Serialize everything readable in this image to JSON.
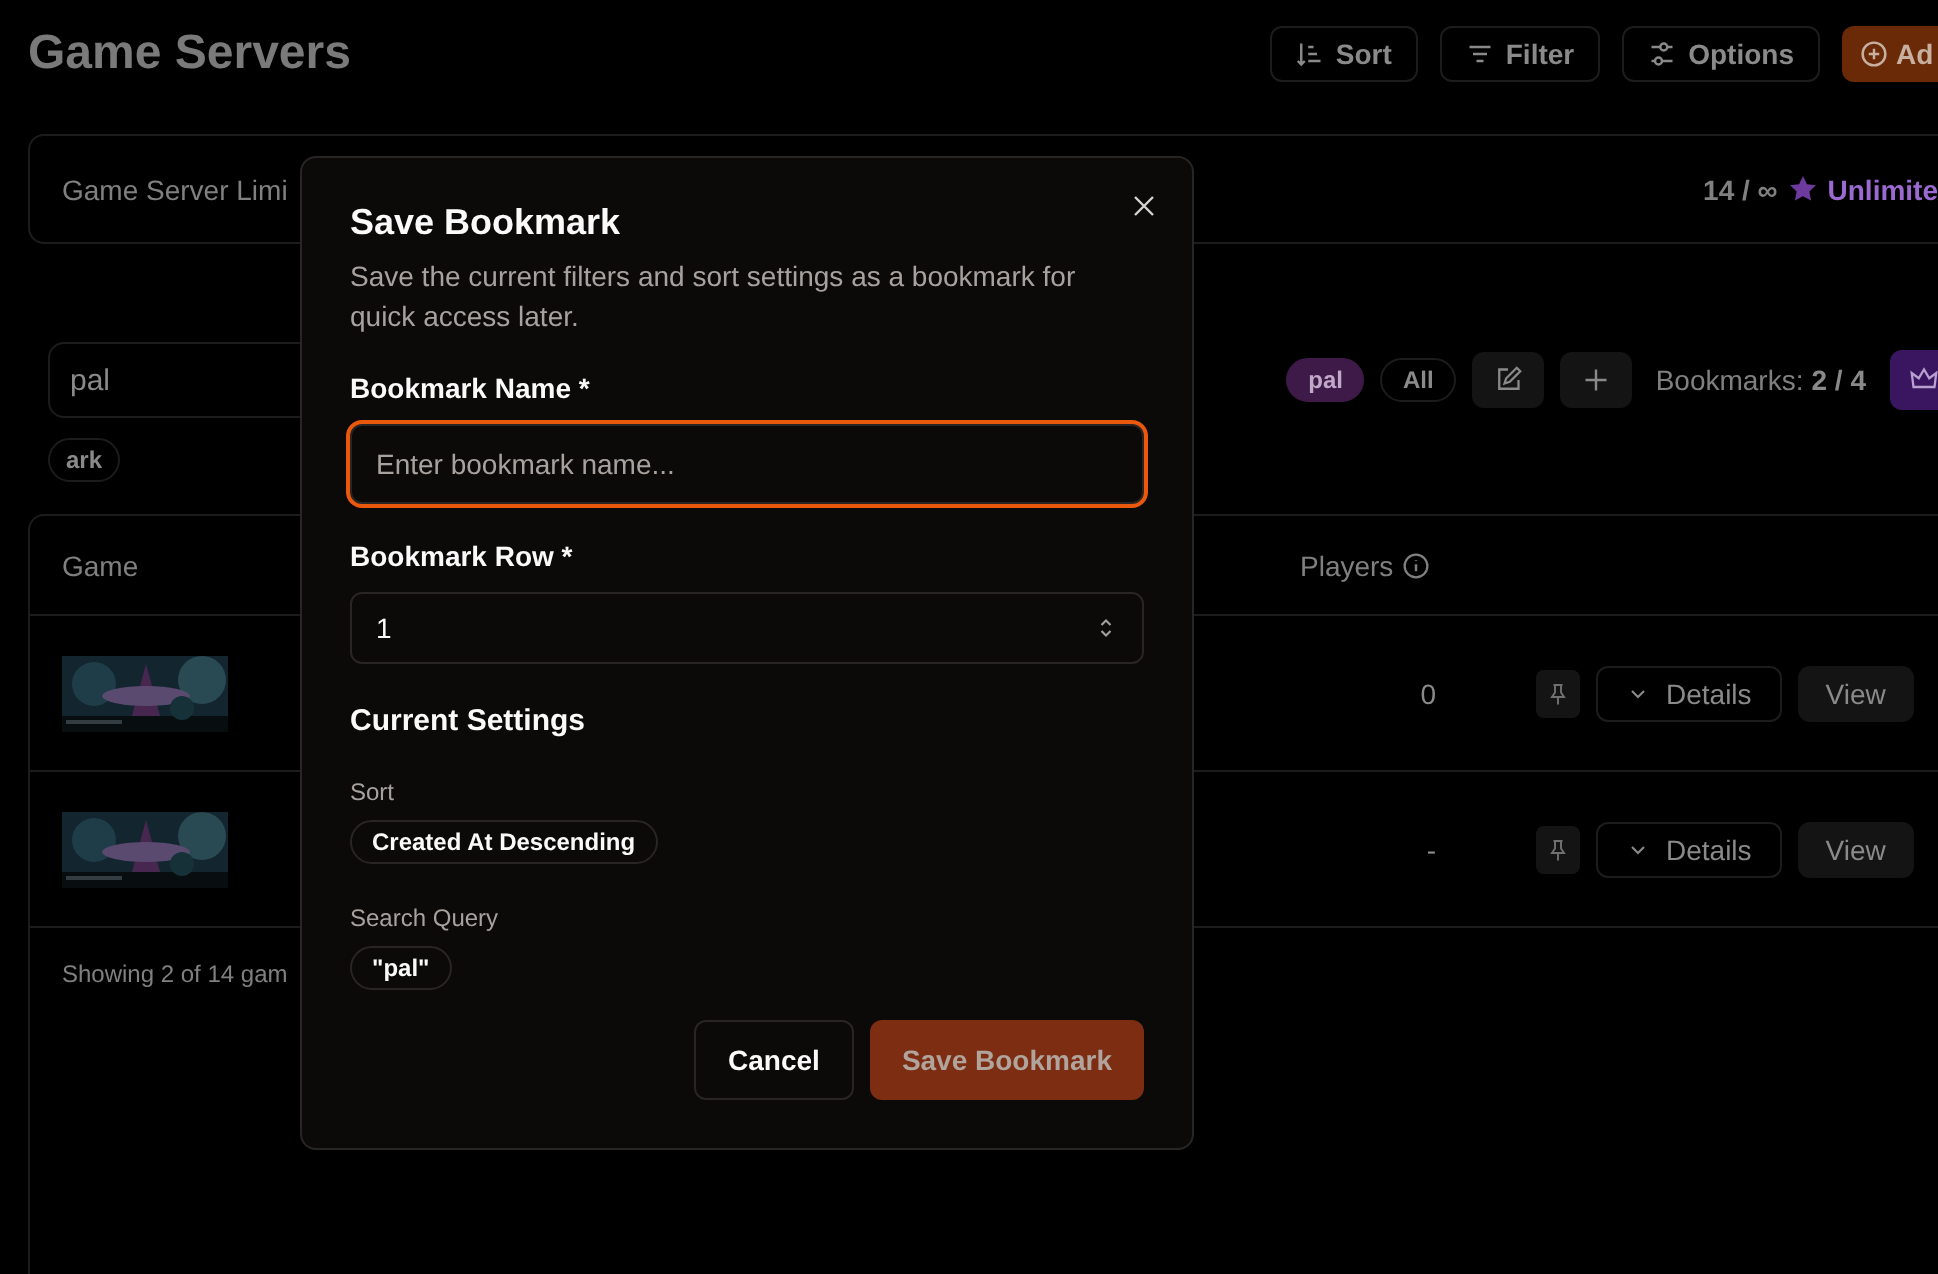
{
  "page": {
    "title": "Game Servers",
    "toolbar": [
      {
        "label": "Sort",
        "kind": "sort"
      },
      {
        "label": "Filter",
        "kind": "filter"
      },
      {
        "label": "Options",
        "kind": "options"
      },
      {
        "label": "Ad",
        "kind": "add"
      }
    ]
  },
  "limits": {
    "label": "Game Server Limi",
    "usage": "14 / ∞",
    "plan": "Unlimite"
  },
  "search": {
    "value": "pal"
  },
  "tags": [
    {
      "label": "ark"
    }
  ],
  "bookmarks": {
    "chips": [
      {
        "label": "pal",
        "selected": true
      },
      {
        "label": "All",
        "selected": false
      }
    ],
    "label": "Bookmarks:",
    "count": "2 / 4"
  },
  "table": {
    "columns": [
      "Game",
      "Players"
    ],
    "rows": [
      {
        "players": "0",
        "details": "Details",
        "view": "View"
      },
      {
        "players": "-",
        "details": "Details",
        "view": "View"
      }
    ]
  },
  "footer": "Showing 2 of 14 gam",
  "dialog": {
    "title": "Save Bookmark",
    "description": "Save the current filters and sort settings as a bookmark for quick access later.",
    "fields": [
      {
        "kind": "text",
        "label": "Bookmark Name *",
        "placeholder": "Enter bookmark name...",
        "focused": true
      },
      {
        "kind": "select",
        "label": "Bookmark Row *",
        "value": "1",
        "focused": false
      }
    ],
    "settings_title": "Current Settings",
    "settings": [
      {
        "label": "Sort",
        "value": "Created At Descending"
      },
      {
        "label": "Search Query",
        "value": "\"pal\""
      }
    ],
    "buttons": [
      {
        "label": "Cancel",
        "kind": "secondary",
        "disabled": false
      },
      {
        "label": "Save Bookmark",
        "kind": "primary",
        "disabled": true
      }
    ]
  }
}
